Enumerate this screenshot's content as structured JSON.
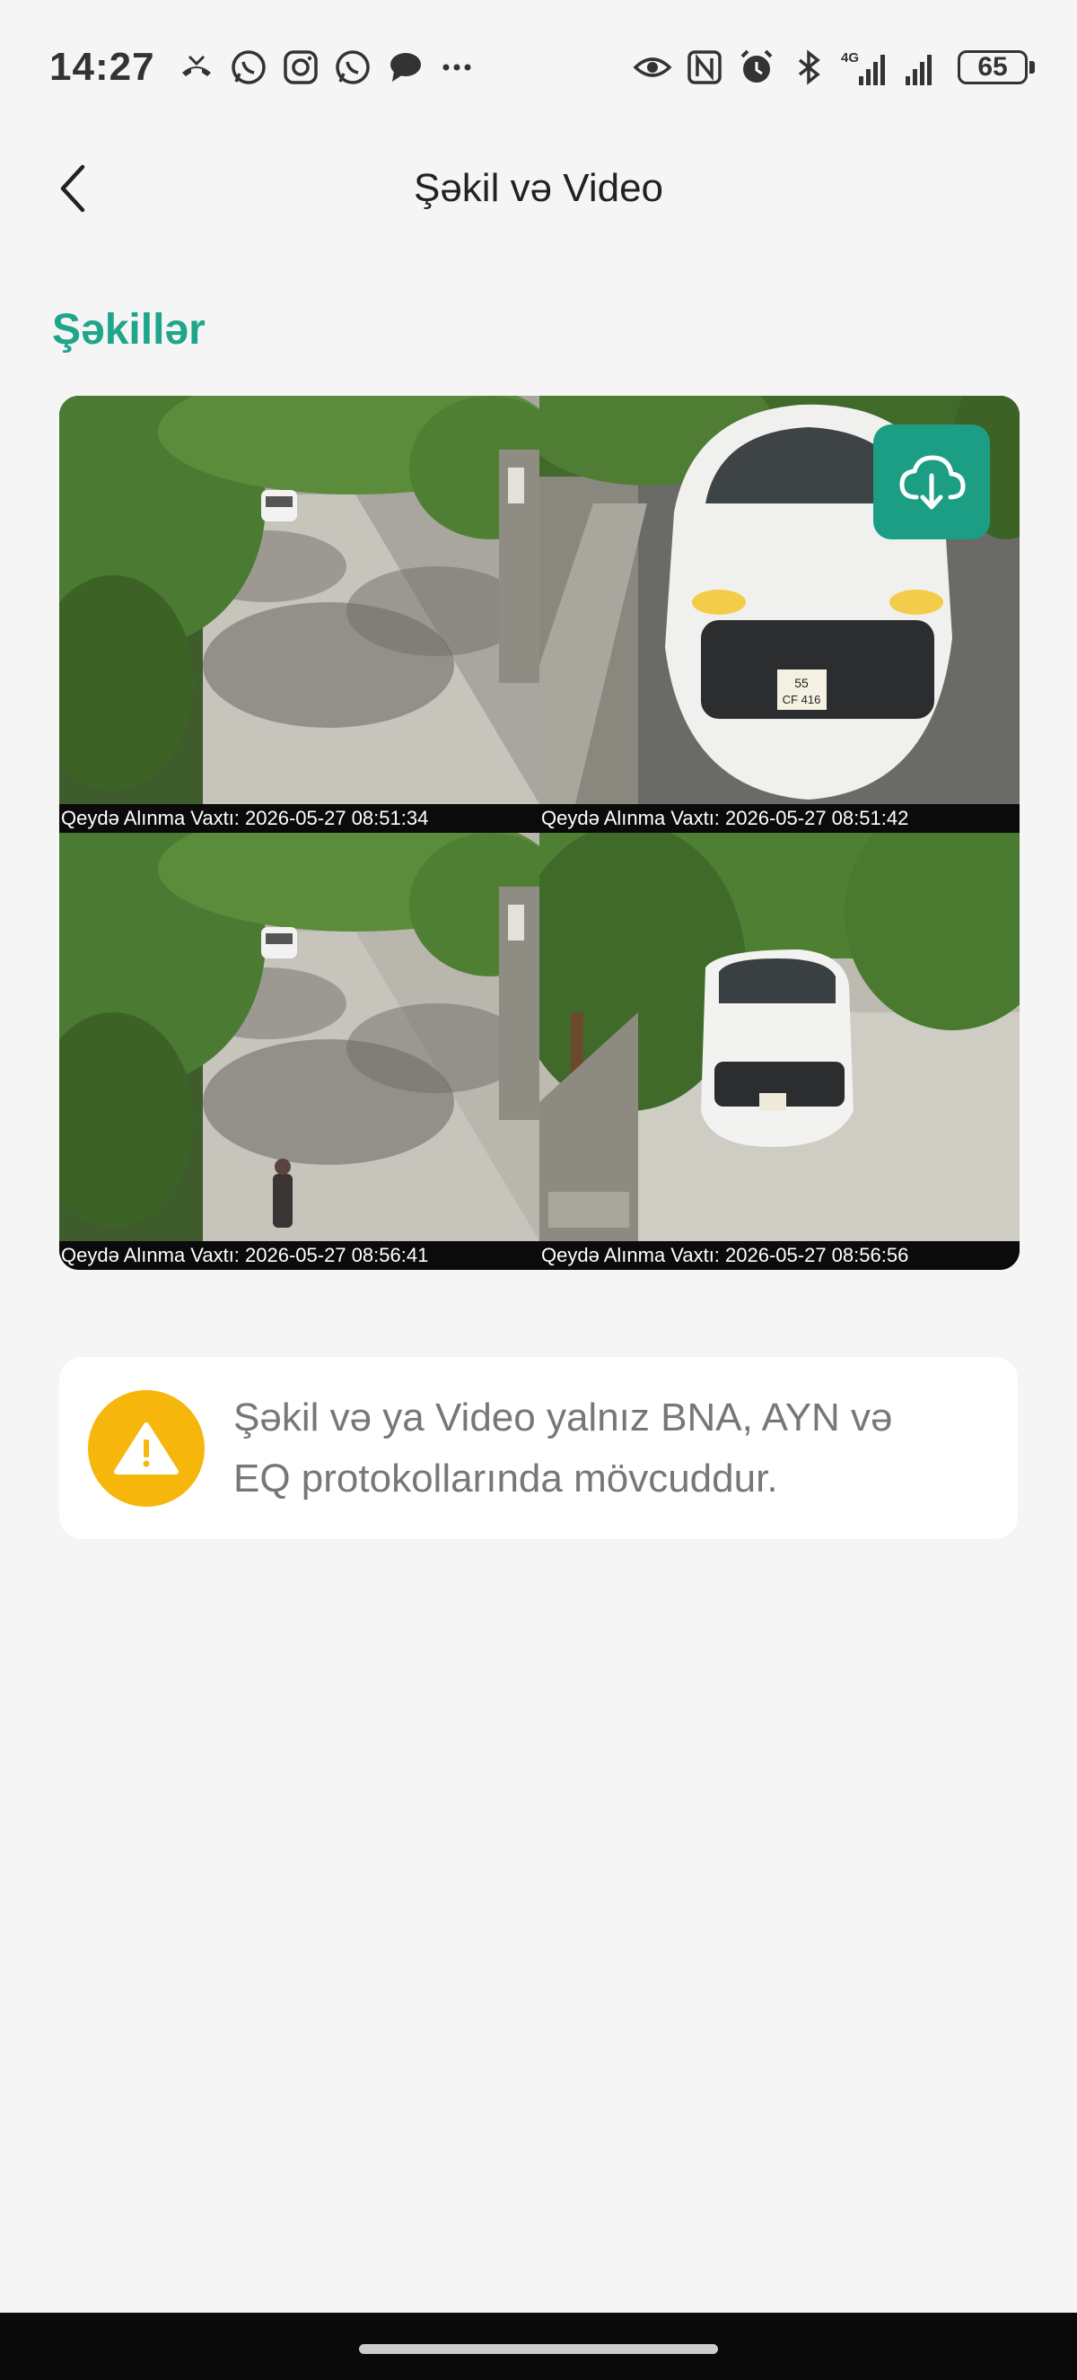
{
  "status_bar": {
    "time": "14:27",
    "battery": "65",
    "network": "4G",
    "left_icons": [
      "missed-call-icon",
      "whatsapp-business-icon",
      "instagram-icon",
      "whatsapp-icon",
      "chat-bubble-icon",
      "more-dots-icon"
    ],
    "right_icons": [
      "eye-icon",
      "nfc-icon",
      "alarm-icon",
      "bluetooth-icon",
      "signal-4g-icon",
      "signal-icon",
      "battery-icon"
    ]
  },
  "header": {
    "title": "Şəkil və Video",
    "back_icon": "chevron-left-icon"
  },
  "section": {
    "title": "Şəkillər"
  },
  "photos": [
    {
      "caption": "Qeydə Alınma Vaxtı: 2026-05-27 08:51:34",
      "plate": ""
    },
    {
      "caption": "Qeydə Alınma Vaxtı: 2026-05-27 08:51:42",
      "plate_line1": "55",
      "plate_line2": "CF 416"
    },
    {
      "caption": "Qeydə Alınma Vaxtı: 2026-05-27 08:56:41",
      "plate": ""
    },
    {
      "caption": "Qeydə Alınma Vaxtı: 2026-05-27 08:56:56",
      "plate": ""
    }
  ],
  "download": {
    "icon": "cloud-download-icon"
  },
  "notice": {
    "icon": "warning-icon",
    "text": "Şəkil və ya Video yalnız BNA, AYN və EQ  protokollarında mövcuddur."
  },
  "colors": {
    "accent": "#1fa58a",
    "download_bg": "#1b9e84",
    "warning": "#f6b60b",
    "background": "#f5f5f5"
  }
}
